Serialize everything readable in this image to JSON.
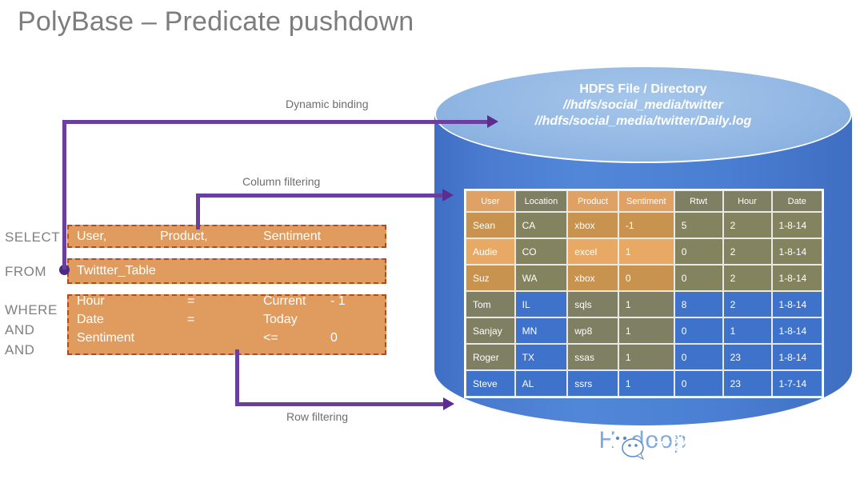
{
  "slide": {
    "title": "PolyBase – Predicate pushdown"
  },
  "cylinder": {
    "heading": "HDFS File / Directory",
    "path1": "//hdfs/social_media/twitter",
    "path2": "//hdfs/social_media/twitter/Daily.log",
    "label": "Hadoop",
    "body_color": "#4a7bd0",
    "top_color": "#93b8e4"
  },
  "annotations": {
    "dynamic_binding": "Dynamic binding",
    "column_filtering": "Column filtering",
    "row_filtering": "Row filtering",
    "line_color": "#6b3fa0"
  },
  "query": {
    "keywords": [
      "SELECT",
      "FROM",
      "WHERE",
      "AND",
      "AND"
    ],
    "select_columns": [
      "User,",
      "Product,",
      "Sentiment"
    ],
    "from_table": "Twittter_Table",
    "conditions": [
      {
        "field": "Hour",
        "op": "=",
        "value": "Current",
        "extra": "- 1"
      },
      {
        "field": "Date",
        "op": "=",
        "value": "Today",
        "extra": ""
      },
      {
        "field": "Sentiment",
        "op": "<=",
        "value": "0",
        "extra": ""
      }
    ],
    "box_color": "#e09c5e",
    "border_color": "#b5481f"
  },
  "table": {
    "columns": [
      "User",
      "Location",
      "Product",
      "Sentiment",
      "Rtwt",
      "Hour",
      "Date"
    ],
    "rows": [
      {
        "cells": [
          "Sean",
          "CA",
          "xbox",
          "-1",
          "5",
          "2",
          "1-8-14"
        ]
      },
      {
        "cells": [
          "Audie",
          "CO",
          "excel",
          "1",
          "0",
          "2",
          "1-8-14"
        ]
      },
      {
        "cells": [
          "Suz",
          "WA",
          "xbox",
          "0",
          "0",
          "2",
          "1-8-14"
        ]
      },
      {
        "cells": [
          "Tom",
          "IL",
          "sqls",
          "1",
          "8",
          "2",
          "1-8-14"
        ]
      },
      {
        "cells": [
          "Sanjay",
          "MN",
          "wp8",
          "1",
          "0",
          "1",
          "1-8-14"
        ]
      },
      {
        "cells": [
          "Roger",
          "TX",
          "ssas",
          "1",
          "0",
          "23",
          "1-8-14"
        ]
      },
      {
        "cells": [
          "Steve",
          "AL",
          "ssrs",
          "1",
          "0",
          "23",
          "1-7-14"
        ]
      }
    ],
    "colors": {
      "header_orange": "#dfa264",
      "orange_dim": "#c8924f",
      "orange_bright": "#e7a964",
      "olive": "#7f7f63",
      "blue": "#3f73cb"
    }
  },
  "watermark": {
    "text": "大数据技术与架构",
    "icon": "wechat-icon"
  }
}
